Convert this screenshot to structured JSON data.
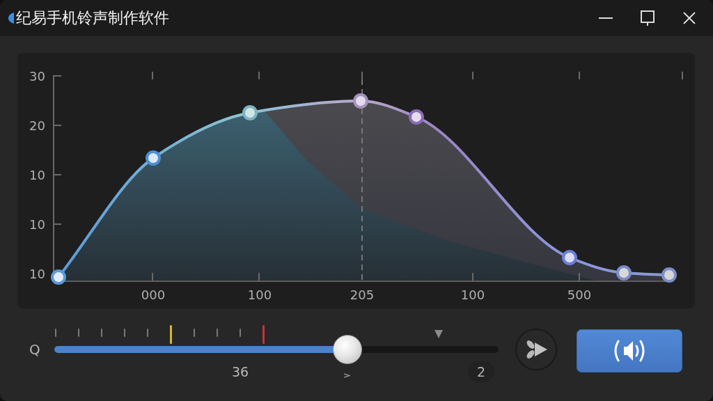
{
  "window": {
    "title": "纪易手机铃声制作软件"
  },
  "chart": {
    "y_tick_labels": [
      "30",
      "20",
      "10",
      "10",
      "10"
    ],
    "x_tick_labels": [
      "000",
      "100",
      "205",
      "100",
      "500"
    ]
  },
  "slider": {
    "label": "Q",
    "level": 0.66,
    "marks": [
      {
        "kind": "minor",
        "color": "#7a7a7a"
      },
      {
        "kind": "minor",
        "color": "#7a7a7a"
      },
      {
        "kind": "minor",
        "color": "#7a7a7a"
      },
      {
        "kind": "minor",
        "color": "#7a7a7a"
      },
      {
        "kind": "minor",
        "color": "#7a7a7a"
      },
      {
        "kind": "major",
        "color": "#d9b526"
      },
      {
        "kind": "minor",
        "color": "#7a7a7a"
      },
      {
        "kind": "minor",
        "color": "#7a7a7a"
      },
      {
        "kind": "minor",
        "color": "#7a7a7a"
      },
      {
        "kind": "major",
        "color": "#c8323c"
      }
    ],
    "value_label": "36",
    "badge": "2"
  }
}
